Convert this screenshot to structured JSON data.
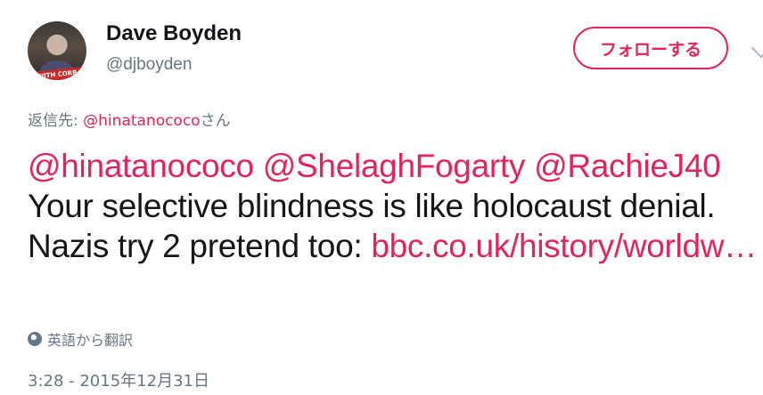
{
  "author": {
    "display_name": "Dave Boyden",
    "handle": "@djboyden",
    "avatar_banner_text": "WITH CORB"
  },
  "follow_button": {
    "label": "フォローする"
  },
  "reply_to": {
    "prefix": "返信先: ",
    "user": "@hinatanococo",
    "suffix": "さん"
  },
  "tweet": {
    "mention1": "@hinatanococo",
    "mention2": "@ShelaghFogarty",
    "mention3": "@RachieJ40",
    "text": " Your selective blindness is like holocaust denial. Nazis try 2 pretend too: ",
    "url": "bbc.co.uk/history/worldw…"
  },
  "translate": {
    "label": "英語から翻訳",
    "icon": "globe-icon"
  },
  "timestamp": "3:28 - 2015年12月31日",
  "colors": {
    "accent": "#e0245e",
    "secondary_text": "#657786",
    "primary_text": "#14171a"
  }
}
